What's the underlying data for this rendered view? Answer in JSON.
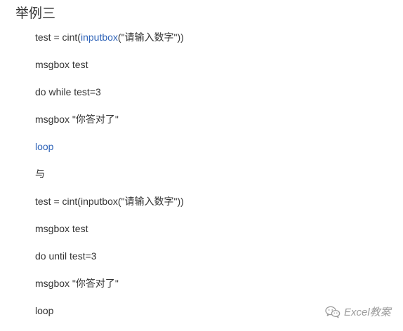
{
  "heading": "举例三",
  "lines": [
    {
      "pre": "test = cint(",
      "kw": "inputbox",
      "post": "(\"请输入数字\"))"
    },
    {
      "pre": "msgbox test",
      "kw": "",
      "post": ""
    },
    {
      "pre": "do while test=3",
      "kw": "",
      "post": ""
    },
    {
      "pre": "msgbox \"你答对了\"",
      "kw": "",
      "post": ""
    },
    {
      "pre": "",
      "kw": "loop",
      "post": ""
    },
    {
      "pre": "与",
      "kw": "",
      "post": ""
    },
    {
      "pre": "test = cint(inputbox(\"请输入数字\"))",
      "kw": "",
      "post": ""
    },
    {
      "pre": "msgbox test",
      "kw": "",
      "post": ""
    },
    {
      "pre": "do until test=3",
      "kw": "",
      "post": ""
    },
    {
      "pre": "msgbox \"你答对了\"",
      "kw": "",
      "post": ""
    },
    {
      "pre": "loop",
      "kw": "",
      "post": ""
    }
  ],
  "watermark": {
    "text": "Excel教案",
    "icon": "wechat-icon"
  },
  "colors": {
    "text": "#333333",
    "keyword": "#2e63b8",
    "watermark": "#9a9a9a"
  }
}
